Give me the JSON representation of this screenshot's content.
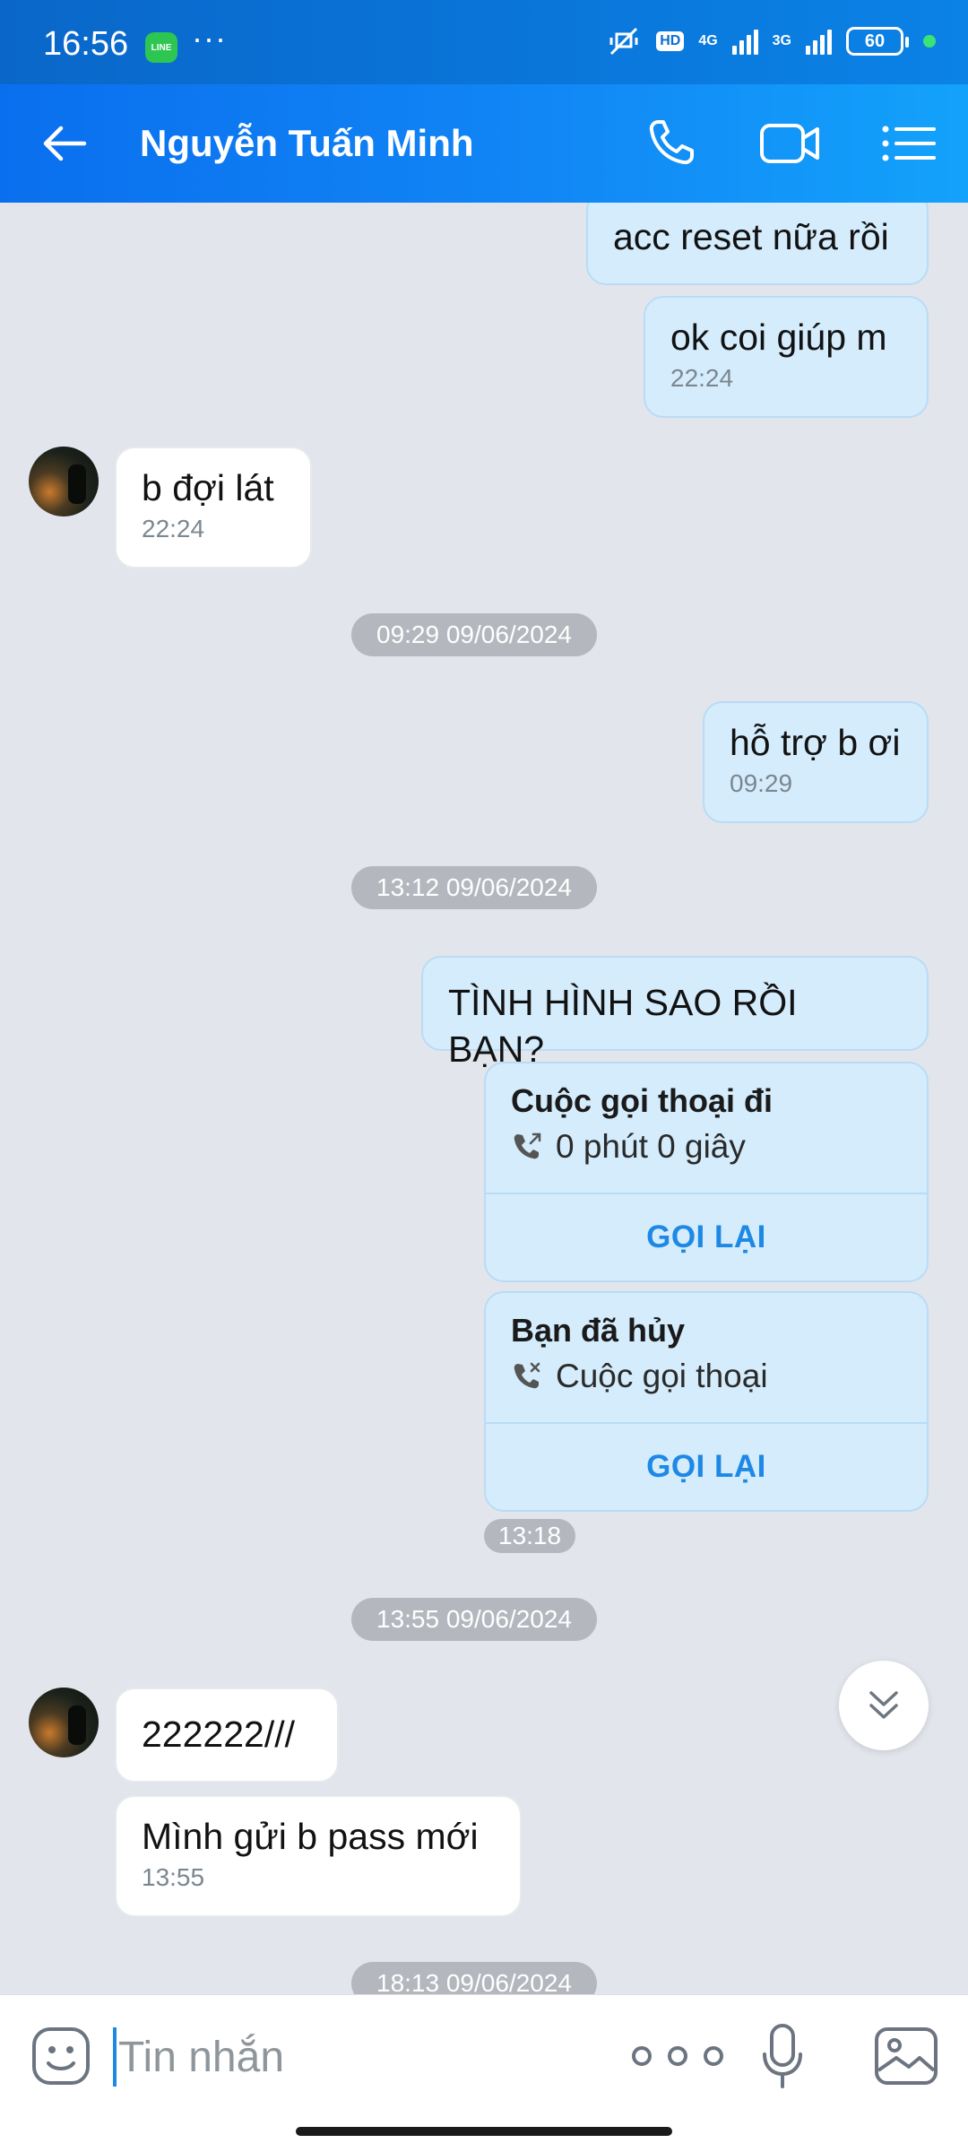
{
  "status_bar": {
    "time": "16:56",
    "line_badge": "LINE",
    "more": "···",
    "hd": "HD",
    "net1": "4G",
    "net2": "3G",
    "battery": "60"
  },
  "header": {
    "contact_name": "Nguyễn Tuấn Minh",
    "icons": [
      "back-arrow-icon",
      "phone-icon",
      "video-camera-icon",
      "menu-list-icon"
    ]
  },
  "messages": {
    "m1": {
      "text": "acc reset nữa rồi"
    },
    "m2": {
      "text": "ok coi giúp m",
      "time": "22:24"
    },
    "m3": {
      "text": "b đợi lát",
      "time": "22:24"
    },
    "date1": "09:29 09/06/2024",
    "m4": {
      "text": "hỗ trợ b ơi",
      "time": "09:29"
    },
    "date2": "13:12 09/06/2024",
    "m5": {
      "text": "TÌNH HÌNH SAO RỒI BẠN?"
    },
    "call1": {
      "title": "Cuộc gọi thoại đi",
      "detail": "0 phút 0 giây",
      "action": "GỌI LẠI"
    },
    "call2": {
      "title": "Bạn đã hủy",
      "detail": "Cuộc gọi thoại",
      "action": "GỌI LẠI"
    },
    "call_time": "13:18",
    "date3": "13:55 09/06/2024",
    "m6": {
      "text": "222222///"
    },
    "m7": {
      "text": "Mình gửi b pass mới",
      "time": "13:55"
    },
    "date4": "18:13 09/06/2024"
  },
  "input_bar": {
    "placeholder": "Tin nhắn"
  },
  "colors": {
    "header_gradient_start": "#0a6fee",
    "header_gradient_end": "#13a2fb",
    "outgoing_bubble": "#d4ecfc",
    "incoming_bubble": "#ffffff",
    "chat_background": "#e2e6ec",
    "accent": "#1e88e5"
  }
}
